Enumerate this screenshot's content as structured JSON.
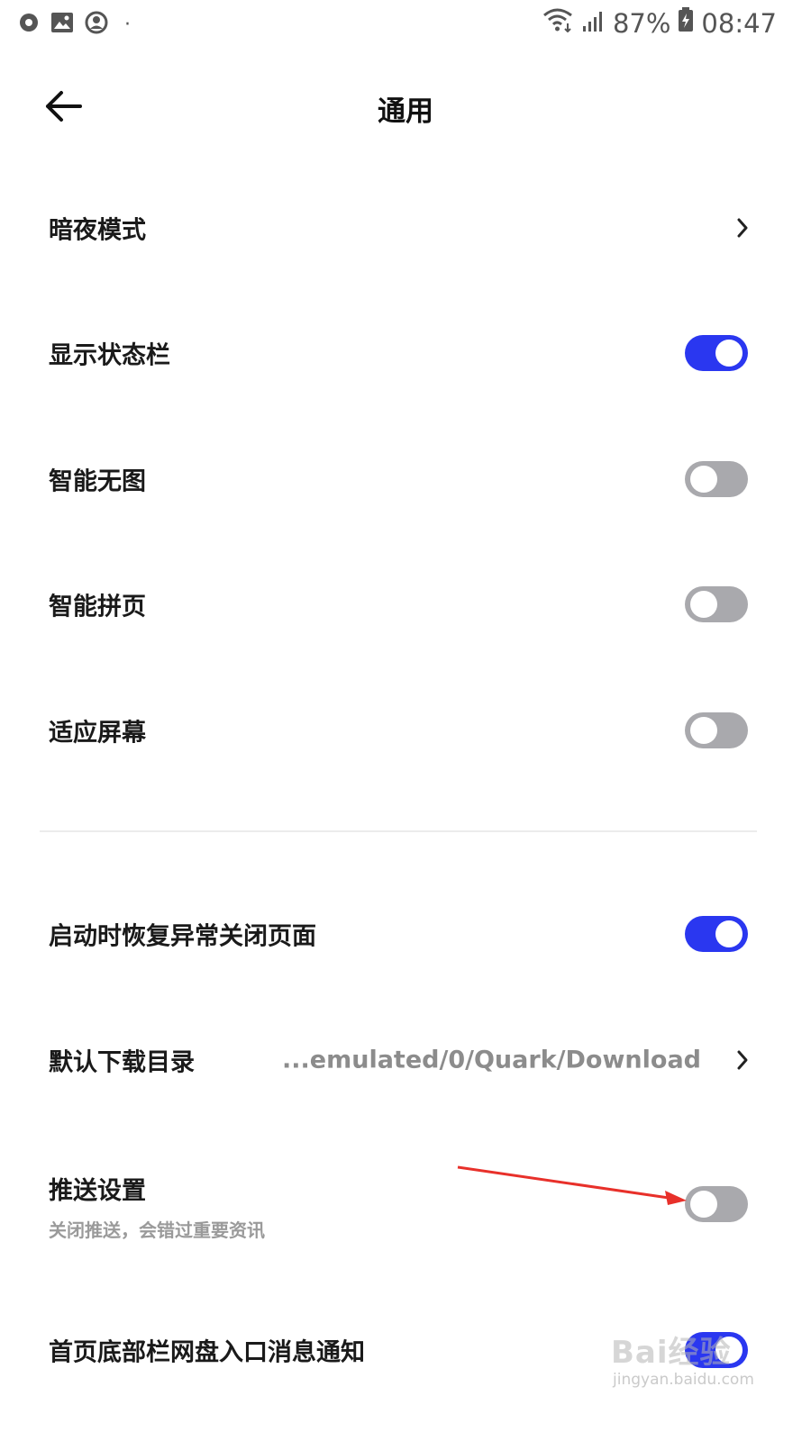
{
  "status_bar": {
    "battery": "87%",
    "time": "08:47",
    "dot": "·",
    "icons_left": [
      "circle-icon",
      "image-icon",
      "account-icon",
      "dot-icon"
    ],
    "icons_right": [
      "wifi-icon",
      "signal-icon",
      "battery-charging-icon"
    ]
  },
  "header": {
    "title": "通用",
    "back_icon": "arrow-left-icon"
  },
  "settings": [
    {
      "label": "暗夜模式",
      "control": "chevron"
    },
    {
      "label": "显示状态栏",
      "control": "toggle",
      "state": "on"
    },
    {
      "label": "智能无图",
      "control": "toggle",
      "state": "off"
    },
    {
      "label": "智能拼页",
      "control": "toggle",
      "state": "off"
    },
    {
      "label": "适应屏幕",
      "control": "toggle",
      "state": "off"
    },
    {
      "label": "启动时恢复异常关闭页面",
      "control": "toggle",
      "state": "on"
    },
    {
      "label": "默认下载目录",
      "control": "chevron",
      "value": "...emulated/0/Quark/Download"
    },
    {
      "label": "推送设置",
      "sublabel": "关闭推送，会错过重要资讯",
      "control": "toggle",
      "state": "off"
    },
    {
      "label": "首页底部栏网盘入口消息通知",
      "control": "toggle",
      "state": "on"
    }
  ],
  "watermark": {
    "main": "Bai经验",
    "sub": "jingyan.baidu.com"
  },
  "colors": {
    "toggle_on": "#2a37f0",
    "toggle_off": "#a9a9ad",
    "annotation_arrow": "#e8302a"
  }
}
